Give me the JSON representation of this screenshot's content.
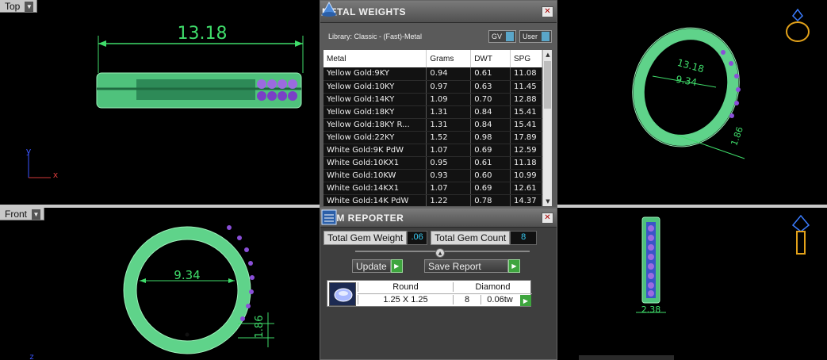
{
  "viewports": {
    "top": {
      "label": "Top",
      "dimension": "13.18",
      "axis_y": "y",
      "axis_x": "x"
    },
    "front": {
      "label": "Front",
      "dimension_diameter": "9.34",
      "dimension_thickness": "1.86",
      "axis_z": "z"
    },
    "perspective": {
      "dimension_top": "13.18",
      "dimension_diameter": "9.34",
      "dimension_thickness": "1.86"
    },
    "side": {
      "dimension_width": "2.38"
    }
  },
  "metal_weights": {
    "title": "METAL WEIGHTS",
    "library": "Library: Classic - (Fast)-Metal",
    "toggle_gv": "GV",
    "toggle_user": "User",
    "columns": [
      "Metal",
      "Grams",
      "DWT",
      "SPG"
    ],
    "rows": [
      [
        "Yellow Gold:9KY",
        "0.94",
        "0.61",
        "11.08"
      ],
      [
        "Yellow Gold:10KY",
        "0.97",
        "0.63",
        "11.45"
      ],
      [
        "Yellow Gold:14KY",
        "1.09",
        "0.70",
        "12.88"
      ],
      [
        "Yellow Gold:18KY",
        "1.31",
        "0.84",
        "15.41"
      ],
      [
        "Yellow Gold:18KY R...",
        "1.31",
        "0.84",
        "15.41"
      ],
      [
        "Yellow Gold:22KY",
        "1.52",
        "0.98",
        "17.89"
      ],
      [
        "White Gold:9K PdW",
        "1.07",
        "0.69",
        "12.59"
      ],
      [
        "White Gold:10KX1",
        "0.95",
        "0.61",
        "11.18"
      ],
      [
        "White Gold:10KW",
        "0.93",
        "0.60",
        "10.99"
      ],
      [
        "White Gold:14KX1",
        "1.07",
        "0.69",
        "12.61"
      ],
      [
        "White Gold:14K PdW",
        "1.22",
        "0.78",
        "14.37"
      ]
    ]
  },
  "gem_reporter": {
    "title": "GEM REPORTER",
    "total_weight_label": "Total Gem Weight",
    "total_weight_value": ".06",
    "total_count_label": "Total Gem Count",
    "total_count_value": "8",
    "update_label": "Update",
    "save_label": "Save Report",
    "gem": {
      "shape": "Round",
      "material": "Diamond",
      "size": "1.25 X 1.25",
      "count": "8",
      "weight": "0.06tw"
    }
  },
  "colors": {
    "ring_green": "#5fd38a",
    "gem_purple": "#9b6be0",
    "dimension": "#3fdc6a",
    "accent_blue": "#37c9f1"
  }
}
